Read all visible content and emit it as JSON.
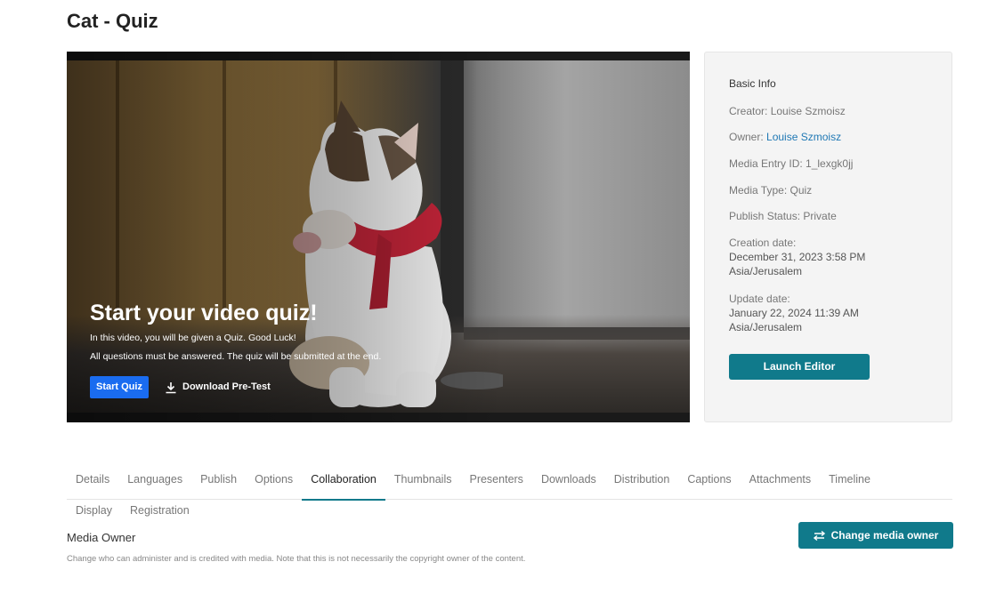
{
  "page": {
    "title": "Cat - Quiz"
  },
  "player": {
    "heading": "Start your video quiz!",
    "line1": "In this video, you will be given a Quiz. Good Luck!",
    "line2": "All questions must be answered. The quiz will be submitted at the end.",
    "start_label": "Start Quiz",
    "download_label": "Download Pre-Test",
    "download_icon": "download-icon"
  },
  "info": {
    "heading": "Basic Info",
    "creator_label": "Creator:",
    "creator": "Louise Szmoisz",
    "owner_label": "Owner:",
    "owner": "Louise Szmoisz",
    "entry_label": "Media Entry ID:",
    "entry_id": "1_lexgk0jj",
    "type_label": "Media Type:",
    "type": "Quiz",
    "status_label": "Publish Status:",
    "status": "Private",
    "created_label": "Creation date:",
    "created": "December 31, 2023 3:58 PM",
    "created_tz": "Asia/Jerusalem",
    "updated_label": "Update date:",
    "updated": "January 22, 2024 11:39 AM",
    "updated_tz": "Asia/Jerusalem",
    "launch_label": "Launch Editor"
  },
  "tabs": {
    "row1": [
      "Details",
      "Languages",
      "Publish",
      "Options",
      "Collaboration",
      "Thumbnails",
      "Presenters",
      "Downloads",
      "Distribution",
      "Captions",
      "Attachments",
      "Timeline"
    ],
    "row2": [
      "Display",
      "Registration"
    ],
    "active": "Collaboration"
  },
  "section": {
    "title": "Media Owner",
    "description": "Change who can administer and is credited with media. Note that this is not necessarily the copyright owner of the content.",
    "button_label": "Change media owner",
    "button_icon": "swap-arrows-icon"
  },
  "colors": {
    "accent": "#107a8b",
    "start_button": "#1a6cf0",
    "link": "#1f78b4"
  }
}
